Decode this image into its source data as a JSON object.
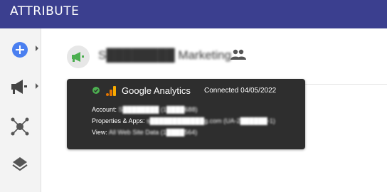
{
  "app": {
    "logo_text": "ATTRIBUTE"
  },
  "sidebar": {
    "items": [
      {
        "icon": "add-icon"
      },
      {
        "icon": "megaphone-icon"
      },
      {
        "icon": "network-icon"
      },
      {
        "icon": "layers-icon"
      }
    ]
  },
  "campaign": {
    "name": "S████████ Marketing",
    "icon": "megaphone-icon"
  },
  "tooltip": {
    "title": "Google Analytics",
    "connected": "Connected 04/05/2022",
    "account_label": "Account: ",
    "account_value": "S████████ (1████688)",
    "properties_label": "Properties & Apps: ",
    "properties_value": "s████████████g.com (UA-2██████-1)",
    "view_label": "View: ",
    "view_value": "All Web Site Data (1████564)"
  },
  "colors": {
    "topbar": "#3b3f8f",
    "add_button": "#4a7ff0",
    "status_green": "#4caf50",
    "tooltip_bg": "#2e2e2e",
    "ga_orange": "#f9ab00",
    "ga_dark": "#e37400"
  }
}
